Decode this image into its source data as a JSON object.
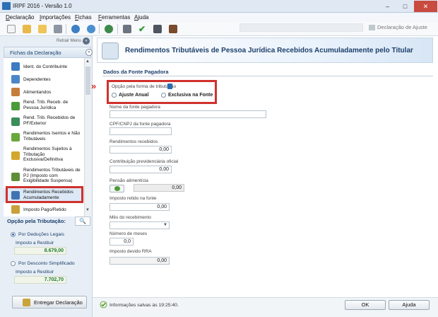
{
  "window": {
    "title": "IRPF 2016 - Versão 1.0",
    "controls": {
      "minimize": "–",
      "maximize": "□",
      "close": "✕"
    }
  },
  "menu": {
    "items": [
      {
        "underline": "D",
        "rest": "eclaração"
      },
      {
        "underline": "I",
        "rest": "mportações"
      },
      {
        "underline": "F",
        "rest": "ichas"
      },
      {
        "underline": "F",
        "rest": "erramentas"
      },
      {
        "underline": "A",
        "rest": "juda"
      }
    ]
  },
  "toolbar": {
    "icons": [
      "new-document-icon",
      "open-folder-icon",
      "folder-icon",
      "trash-icon",
      "import-icon",
      "transmit-icon",
      "globe-icon",
      "print-icon",
      "check-icon",
      "calculator-icon",
      "book-icon"
    ],
    "declaracao_de_ajuste": "Declaração de Ajuste"
  },
  "sidebar": {
    "retrair_label": "Retrair Menu",
    "retrair_icon": "«",
    "fichas_header": "Fichas da Declaração",
    "collapse_icon": "«",
    "fichas": [
      {
        "label": "Ident. do Contribuinte",
        "icon": "person-icon",
        "color": "#3d7bc2"
      },
      {
        "label": "Dependentes",
        "icon": "people-icon",
        "color": "#4c86c8"
      },
      {
        "label": "Alimentandos",
        "icon": "group-icon",
        "color": "#c47d3a"
      },
      {
        "label": "Rend. Trib. Receb. de Pessoa Jurídica",
        "icon": "money-icon",
        "color": "#4b9b3a"
      },
      {
        "label": "Rend. Trib. Recebidos de PF/Exterior",
        "icon": "money-globe-icon",
        "color": "#3b8d5a"
      },
      {
        "label": "Rendimentos Isentos e Não Tributáveis",
        "icon": "shield-icon",
        "color": "#69a83d"
      },
      {
        "label": "Rendimentos Sujeitos à Tributação Exclusiva/Definitiva",
        "icon": "warning-icon",
        "color": "#d3a72c"
      },
      {
        "label": "Rendimentos Tributáveis de PJ (Imposto com Exigibilidade Suspensa)",
        "icon": "money-suspend-icon",
        "color": "#5e8e39"
      },
      {
        "label": "Rendimentos Recebidos Acumuladamente",
        "icon": "accumulated-icon",
        "color": "#3f74b2"
      },
      {
        "label": "Imposto Pago/Retido",
        "icon": "coin-icon",
        "color": "#c9a13c"
      }
    ],
    "opcao_tributacao": "Opção pela Tributação:",
    "search_icon": "🔍",
    "deducoes_legais": "Por Deduções Legais",
    "imposto_restituir_1_label": "Imposto a Restituir",
    "imposto_restituir_1_value": "8.679,00",
    "desconto_simplificado": "Por Desconto Simplificado",
    "imposto_restituir_2_label": "Imposto a Restituir",
    "imposto_restituir_2_value": "7.702,70",
    "entregar": "Entregar Declaração"
  },
  "main": {
    "header_title": "Rendimentos Tributáveis de Pessoa Jurídica Recebidos Acumuladamente pelo Titular",
    "section_title": "Dados da Fonte Pagadora",
    "opcao_forma_label": "Opção pela forma de tributação",
    "ajuste_anual": "Ajuste Anual",
    "exclusiva_fonte": "Exclusiva na Fonte",
    "arrow": "»",
    "fields": {
      "nome_fonte_label": "Nome da fonte pagadora",
      "nome_fonte_value": "",
      "cpf_cnpj_label": "CPF/CNPJ da fonte pagadora",
      "cpf_cnpj_value": "",
      "rendimentos_label": "Rendimentos recebidos",
      "rendimentos_value": "0,00",
      "contribuicao_label": "Contribuição previdenciária oficial",
      "contribuicao_value": "0,00",
      "pensao_label": "Pensão alimentícia",
      "pensao_value": "0,00",
      "imposto_retido_label": "Imposto retido na fonte",
      "imposto_retido_value": "0,00",
      "mes_label": "Mês do recebimento",
      "mes_value": "",
      "numero_meses_label": "Número de meses",
      "numero_meses_value": "0,0",
      "imposto_devido_label": "Imposto devido RRA",
      "imposto_devido_value": "0,00"
    }
  },
  "status": {
    "text": "Informações salvas às 19:25:40.",
    "ok": "OK",
    "ajuda": "Ajuda"
  }
}
